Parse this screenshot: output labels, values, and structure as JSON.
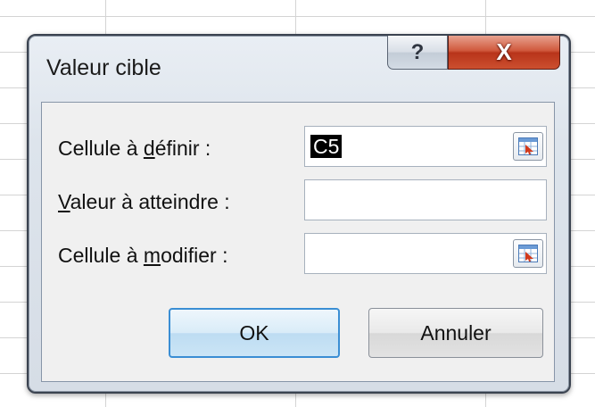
{
  "dialog": {
    "title": "Valeur cible",
    "help_button": "?",
    "close_button": "X"
  },
  "fields": [
    {
      "label_pre": "Cellule à ",
      "label_key": "d",
      "label_post": "éfinir :",
      "value": "C5"
    },
    {
      "label_pre": "",
      "label_key": "V",
      "label_post": "aleur à atteindre :",
      "value": ""
    },
    {
      "label_pre": "Cellule à ",
      "label_key": "m",
      "label_post": "odifier :",
      "value": ""
    }
  ],
  "buttons": {
    "ok": "OK",
    "cancel": "Annuler"
  },
  "icons": {
    "range_selector": "range-selector-icon"
  }
}
